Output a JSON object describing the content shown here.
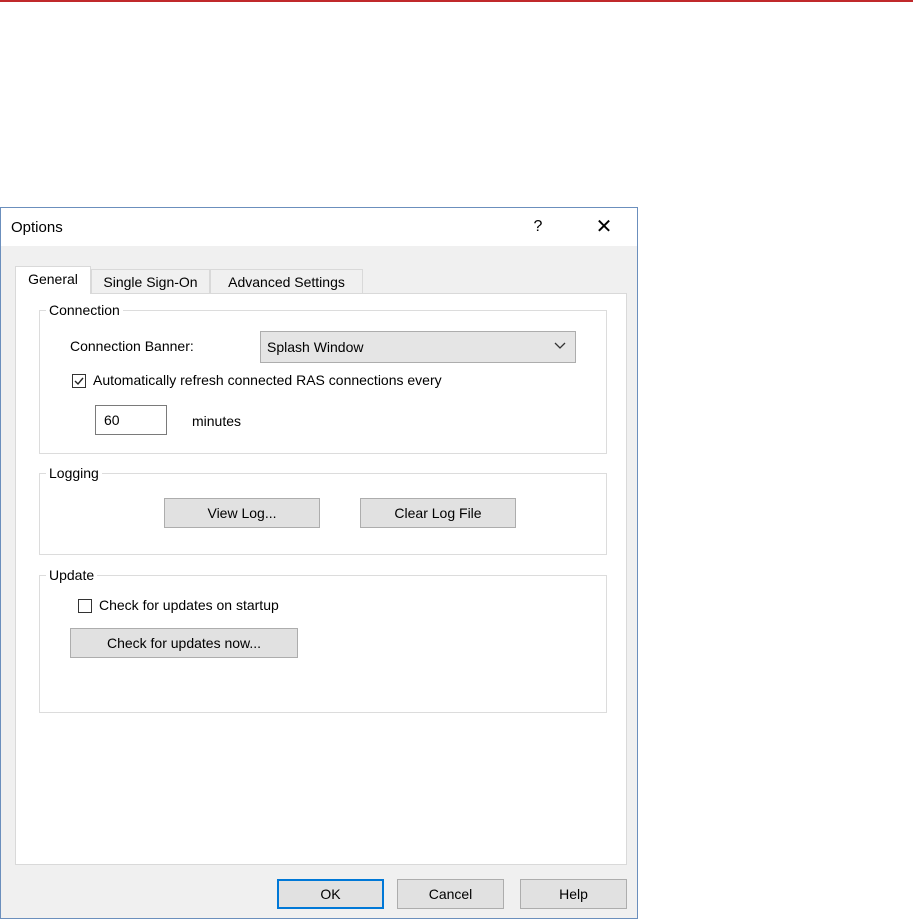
{
  "window": {
    "title": "Options",
    "help_glyph": "?",
    "close_glyph": "✕"
  },
  "tabs": [
    {
      "label": "General",
      "active": true
    },
    {
      "label": "Single Sign-On",
      "active": false
    },
    {
      "label": "Advanced Settings",
      "active": false
    }
  ],
  "connection": {
    "legend": "Connection",
    "banner_label": "Connection Banner:",
    "banner_value": "Splash Window",
    "auto_refresh_label": "Automatically refresh connected RAS connections every",
    "auto_refresh_checked": true,
    "interval_value": "60",
    "interval_unit": "minutes"
  },
  "logging": {
    "legend": "Logging",
    "view_log_label": "View Log...",
    "clear_log_label": "Clear Log File"
  },
  "update": {
    "legend": "Update",
    "check_startup_label": "Check for updates on startup",
    "check_startup_checked": false,
    "check_now_label": "Check for updates now..."
  },
  "footer": {
    "ok_label": "OK",
    "cancel_label": "Cancel",
    "help_label": "Help"
  },
  "colors": {
    "accent_top_line": "#c0292b",
    "default_button_border": "#0078d7",
    "window_border": "#6b8fbd"
  }
}
